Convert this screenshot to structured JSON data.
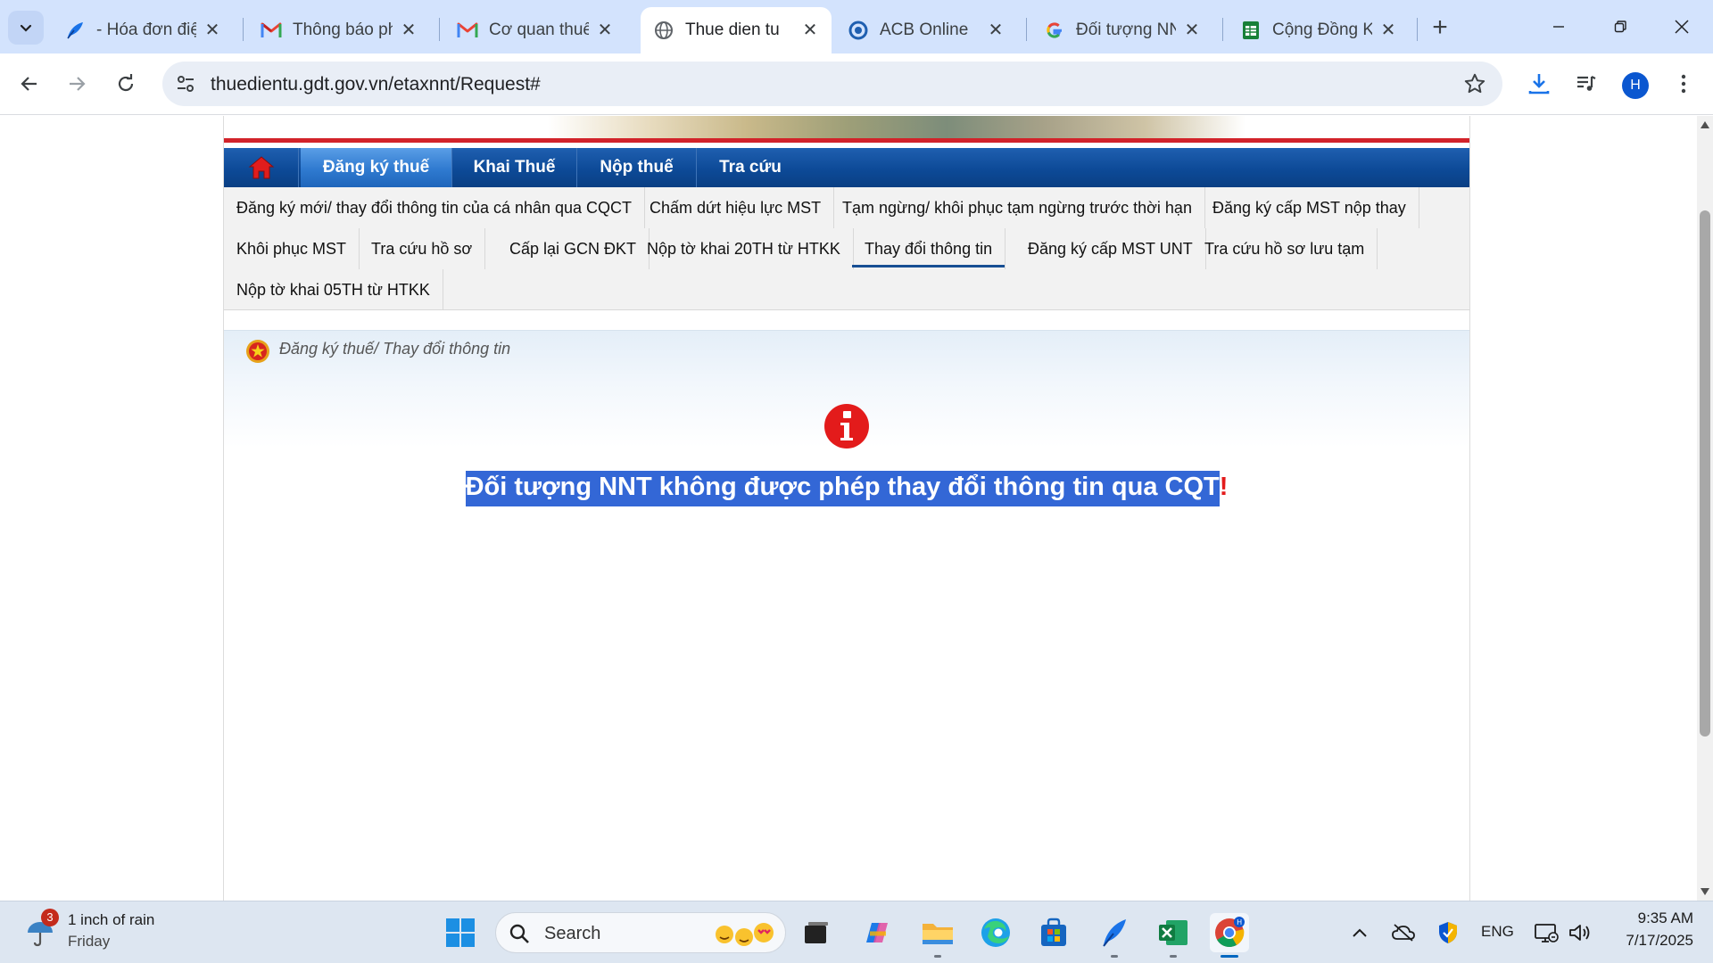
{
  "browser": {
    "tabs": [
      {
        "title": "- Hóa đơn điệ",
        "icon": "feather-icon"
      },
      {
        "title": "Thông báo ph",
        "icon": "gmail-icon"
      },
      {
        "title": "Cơ quan thuế",
        "icon": "gmail-icon"
      },
      {
        "title": "Thue dien tu",
        "icon": "globe-icon",
        "active": true
      },
      {
        "title": "ACB Online",
        "icon": "acb-icon"
      },
      {
        "title": "Đối tượng NN",
        "icon": "google-icon"
      },
      {
        "title": "Cộng Đồng K",
        "icon": "sheet-icon"
      }
    ],
    "close_glyph": "✕",
    "new_tab_glyph": "+",
    "url": "thuedientu.gdt.gov.vn/etaxnnt/Request#",
    "profile_initial": "H"
  },
  "site": {
    "nav": {
      "items": [
        {
          "label": "Đăng ký thuế",
          "active": true
        },
        {
          "label": "Khai Thuế"
        },
        {
          "label": "Nộp thuế"
        },
        {
          "label": "Tra cứu"
        }
      ]
    },
    "submenu": {
      "items": [
        "Đăng ký mới/ thay đổi thông tin của cá nhân qua CQCT",
        "Chấm dứt hiệu lực MST",
        "Tạm ngừng/ khôi phục tạm ngừng trước thời hạn",
        "Đăng ký cấp MST nộp thay",
        "Khôi phục MST",
        "Tra cứu hồ sơ",
        "Cấp lại GCN ĐKT",
        "Nộp tờ khai 20TH từ HTKK",
        "Thay đổi thông tin",
        "Đăng ký cấp MST UNT",
        "Tra cứu hồ sơ lưu tạm",
        "Nộp tờ khai 05TH từ HTKK"
      ],
      "active_index": 8
    },
    "breadcrumb": "Đăng ký thuế/ Thay đổi thông tin",
    "message": {
      "icon": "info-icon",
      "text": "Đối tượng NNT không được phép thay đổi thông tin qua CQT",
      "suffix": "!"
    },
    "colors": {
      "nav_blue": "#0d4a97",
      "accent_red": "#d2232a",
      "selection": "#3367d6"
    }
  },
  "taskbar": {
    "weather": {
      "badge": "3",
      "line1": "1 inch of rain",
      "line2": "Friday"
    },
    "search_placeholder": "Search",
    "tray_language": "ENG",
    "time": "9:35 AM",
    "date": "7/17/2025"
  }
}
